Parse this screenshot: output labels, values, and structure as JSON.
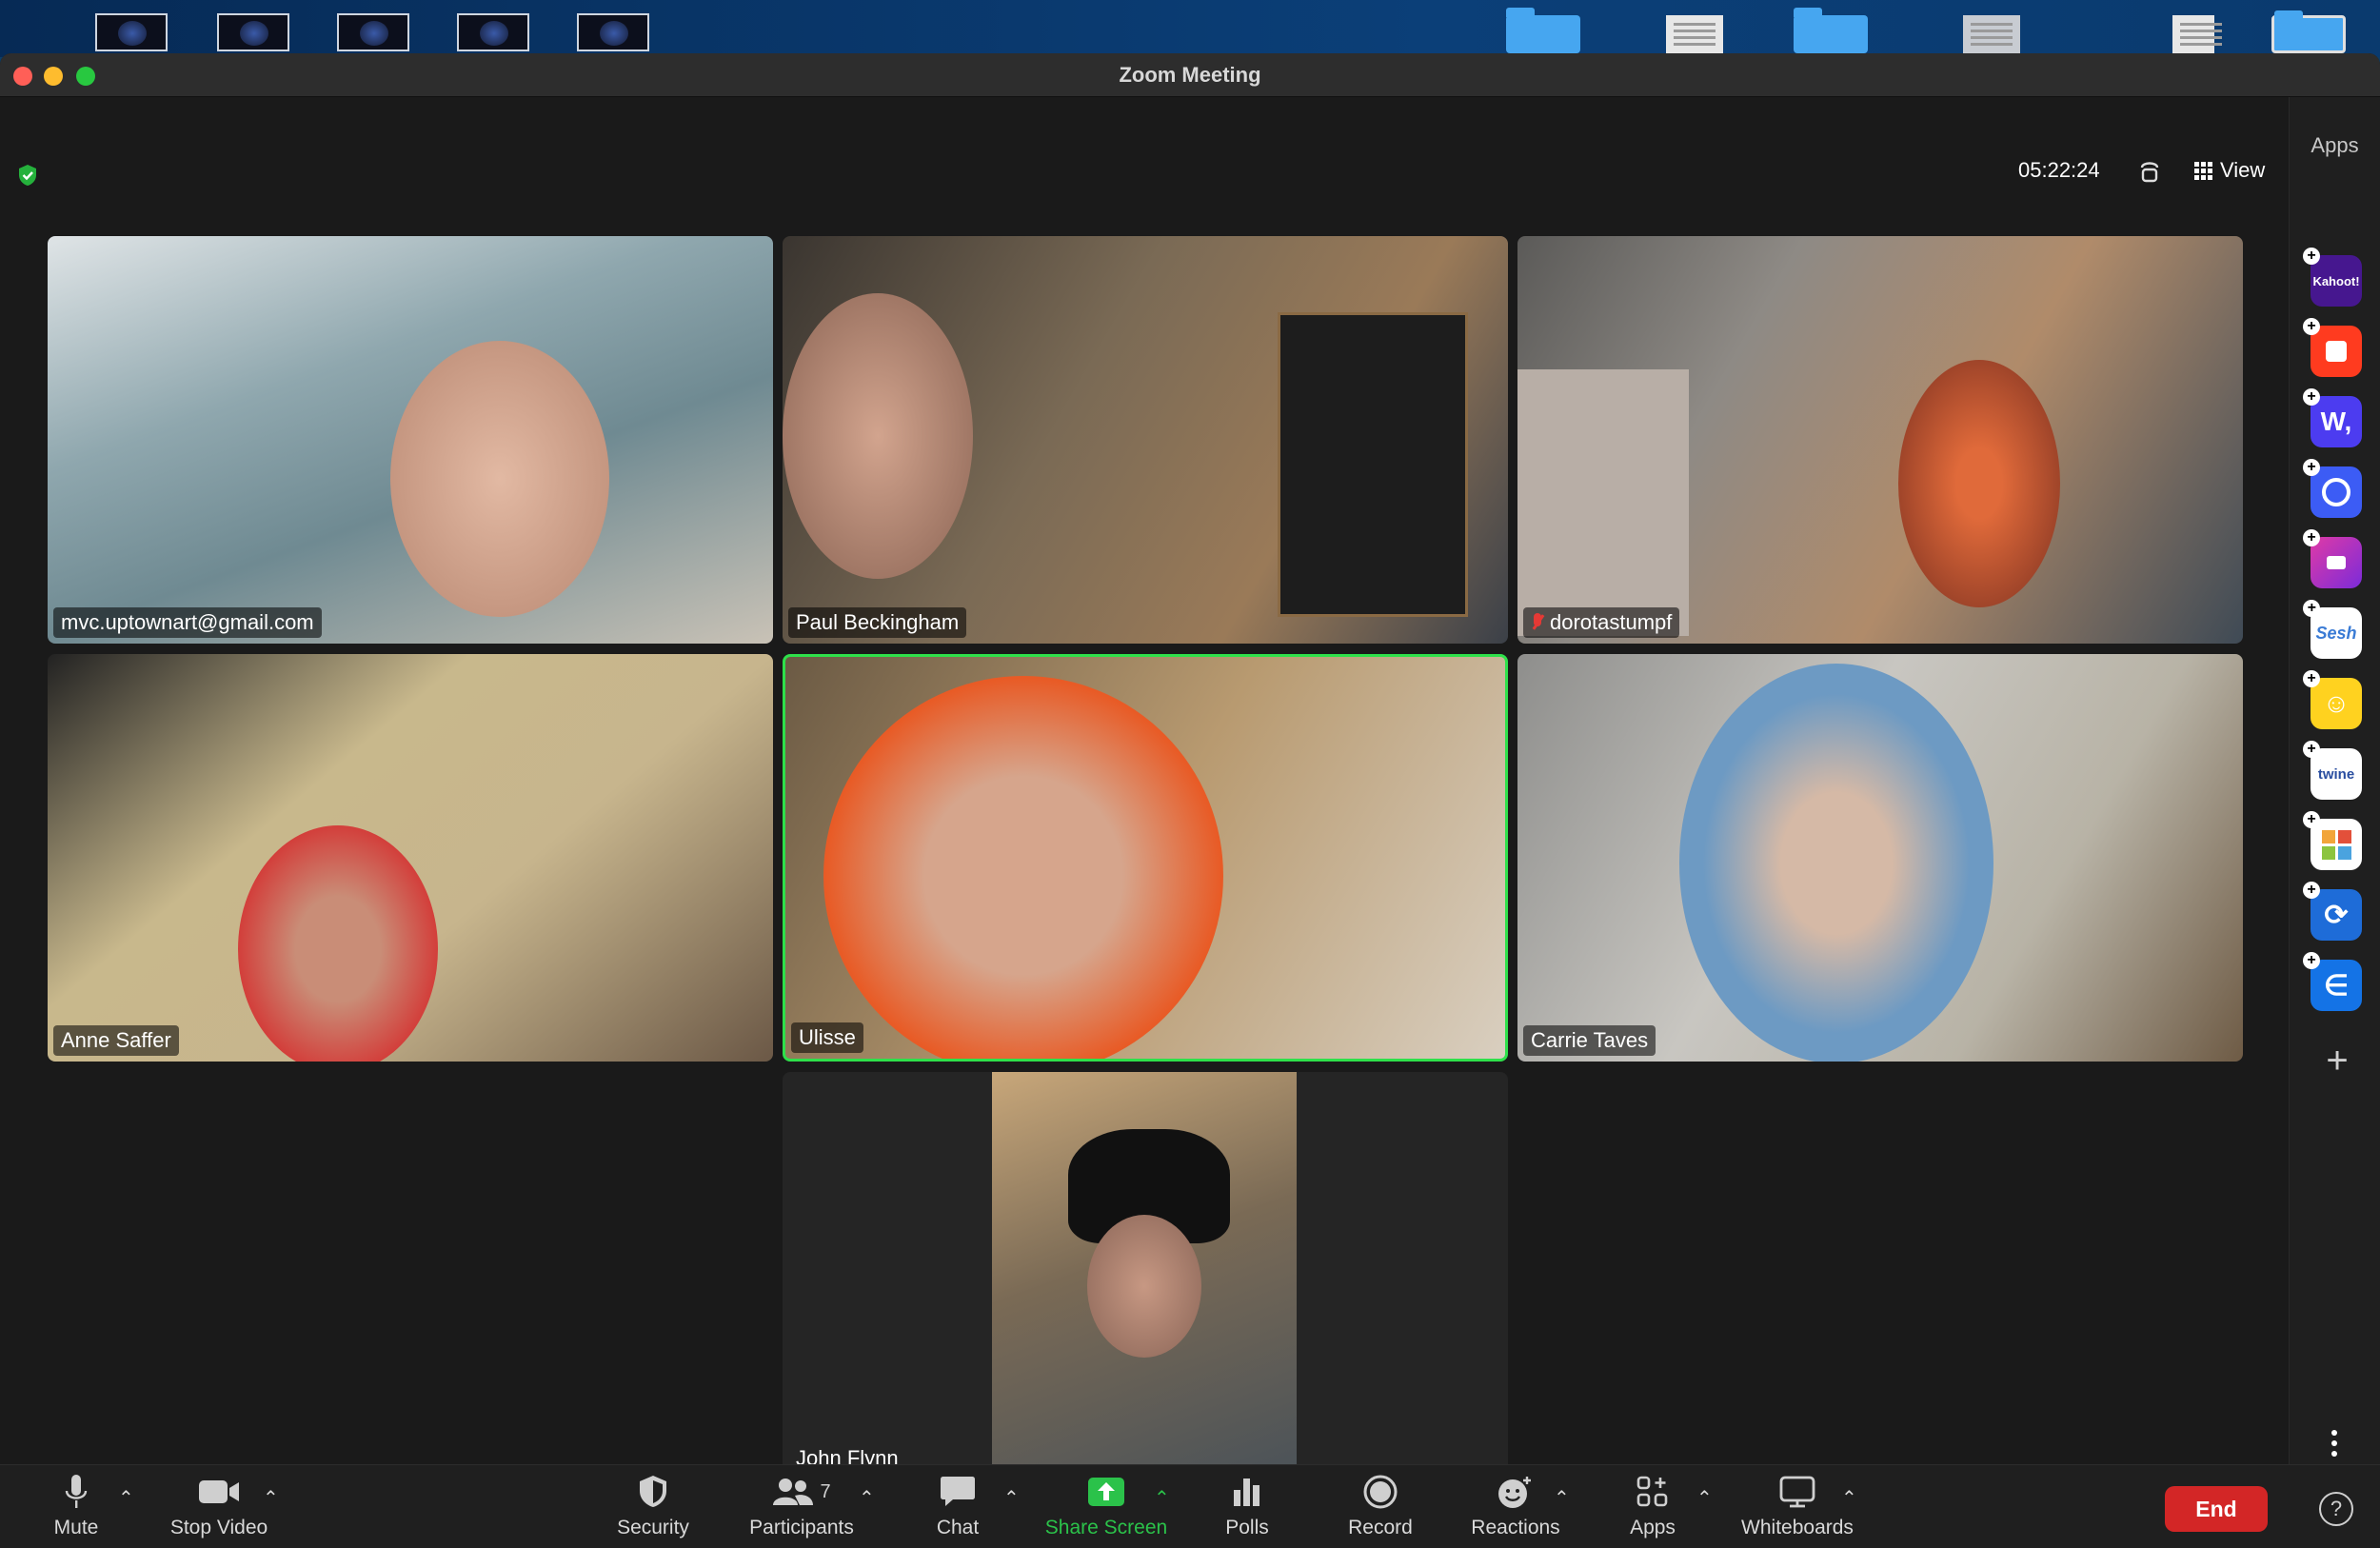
{
  "window": {
    "title": "Zoom Meeting"
  },
  "header": {
    "timer": "05:22:24",
    "view_label": "View"
  },
  "participants": [
    {
      "name": "mvc.uptownart@gmail.com",
      "muted": false
    },
    {
      "name": "Paul Beckingham",
      "muted": false
    },
    {
      "name": "dorotastumpf",
      "muted": true
    },
    {
      "name": "Anne Saffer",
      "muted": false
    },
    {
      "name": "Ulisse",
      "muted": false,
      "active_speaker": true
    },
    {
      "name": "Carrie Taves",
      "muted": false
    },
    {
      "name": "John Flynn",
      "muted": false
    }
  ],
  "apps_panel": {
    "title": "Apps",
    "apps": [
      {
        "name": "Kahoot!",
        "label": "Kahoot!",
        "color": "#46178f"
      },
      {
        "name": "red-app",
        "label": "",
        "color": "#ff3b1f"
      },
      {
        "name": "W app",
        "label": "W,",
        "color": "#4c3cf0"
      },
      {
        "name": "blue-circle-app",
        "label": "",
        "color": "#3c5cf5"
      },
      {
        "name": "purple-video-app",
        "label": "",
        "color": "#a23bd1"
      },
      {
        "name": "Sesh",
        "label": "Sesh",
        "color": "#ffffff"
      },
      {
        "name": "emoji-app",
        "label": "",
        "color": "#ffd21f"
      },
      {
        "name": "twine",
        "label": "twine",
        "color": "#ffffff"
      },
      {
        "name": "grid-app",
        "label": "",
        "color": "#ffffff"
      },
      {
        "name": "sync-app",
        "label": "",
        "color": "#1e6cd8"
      },
      {
        "name": "e-app",
        "label": "",
        "color": "#1473e6"
      }
    ]
  },
  "toolbar": {
    "mute": "Mute",
    "stop_video": "Stop Video",
    "security": "Security",
    "participants": "Participants",
    "participants_count": "7",
    "chat": "Chat",
    "share_screen": "Share Screen",
    "polls": "Polls",
    "record": "Record",
    "reactions": "Reactions",
    "apps": "Apps",
    "whiteboards": "Whiteboards",
    "end": "End",
    "help": "?"
  },
  "colors": {
    "share_green": "#2bc24a",
    "end_red": "#d32626",
    "active_speaker_border": "#2ee04a"
  }
}
